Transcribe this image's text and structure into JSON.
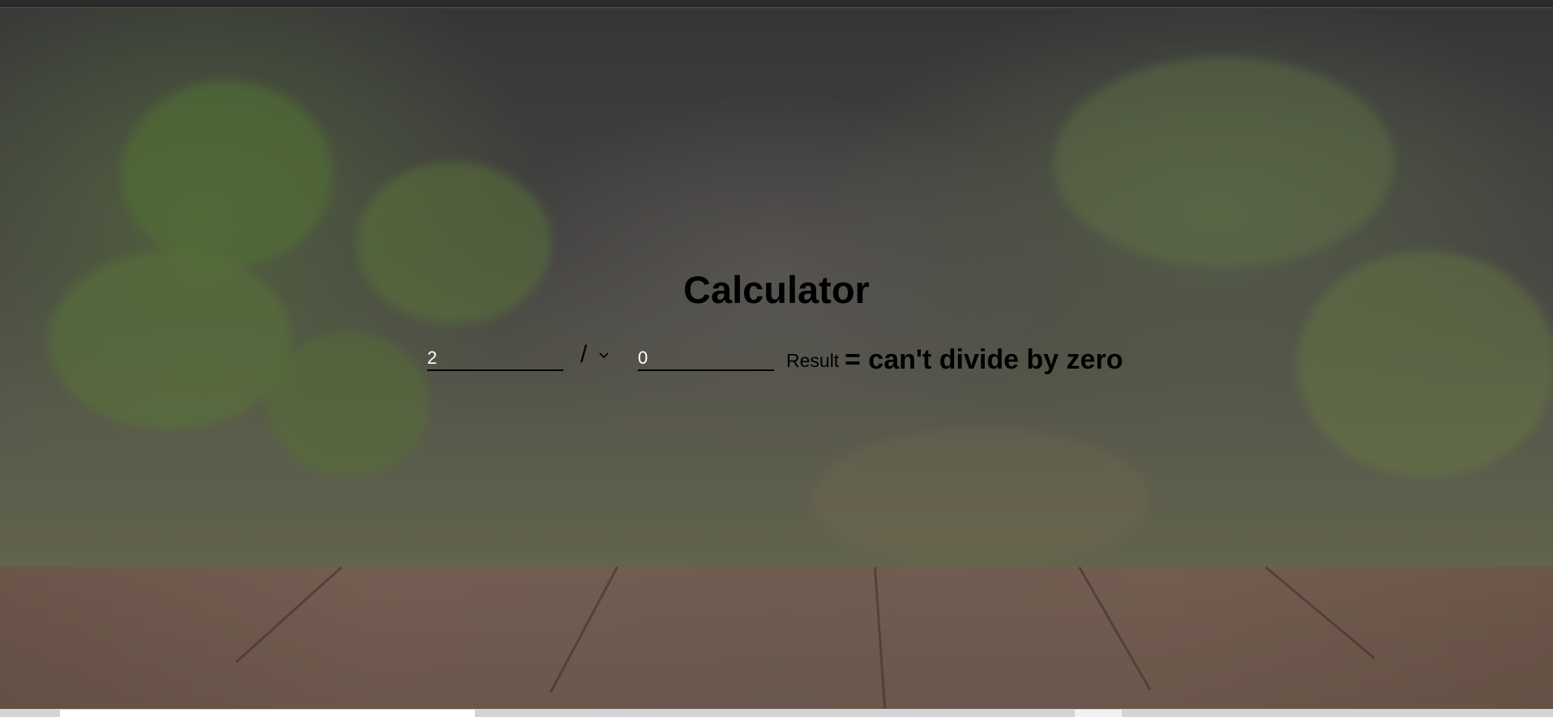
{
  "app": {
    "title": "Calculator"
  },
  "calculator": {
    "first_operand": "2",
    "operator": "/",
    "second_operand": "0",
    "result_label": "Result",
    "result_text": "= can't divide by zero"
  },
  "icons": {
    "operator_dropdown": "chevron-down-icon"
  },
  "colors": {
    "title": "#000000",
    "input_text": "#ffffff",
    "input_underline": "#000000",
    "scrollbar_track": "#d4d4d4",
    "scrollbar_thumb": "#ffffff"
  }
}
